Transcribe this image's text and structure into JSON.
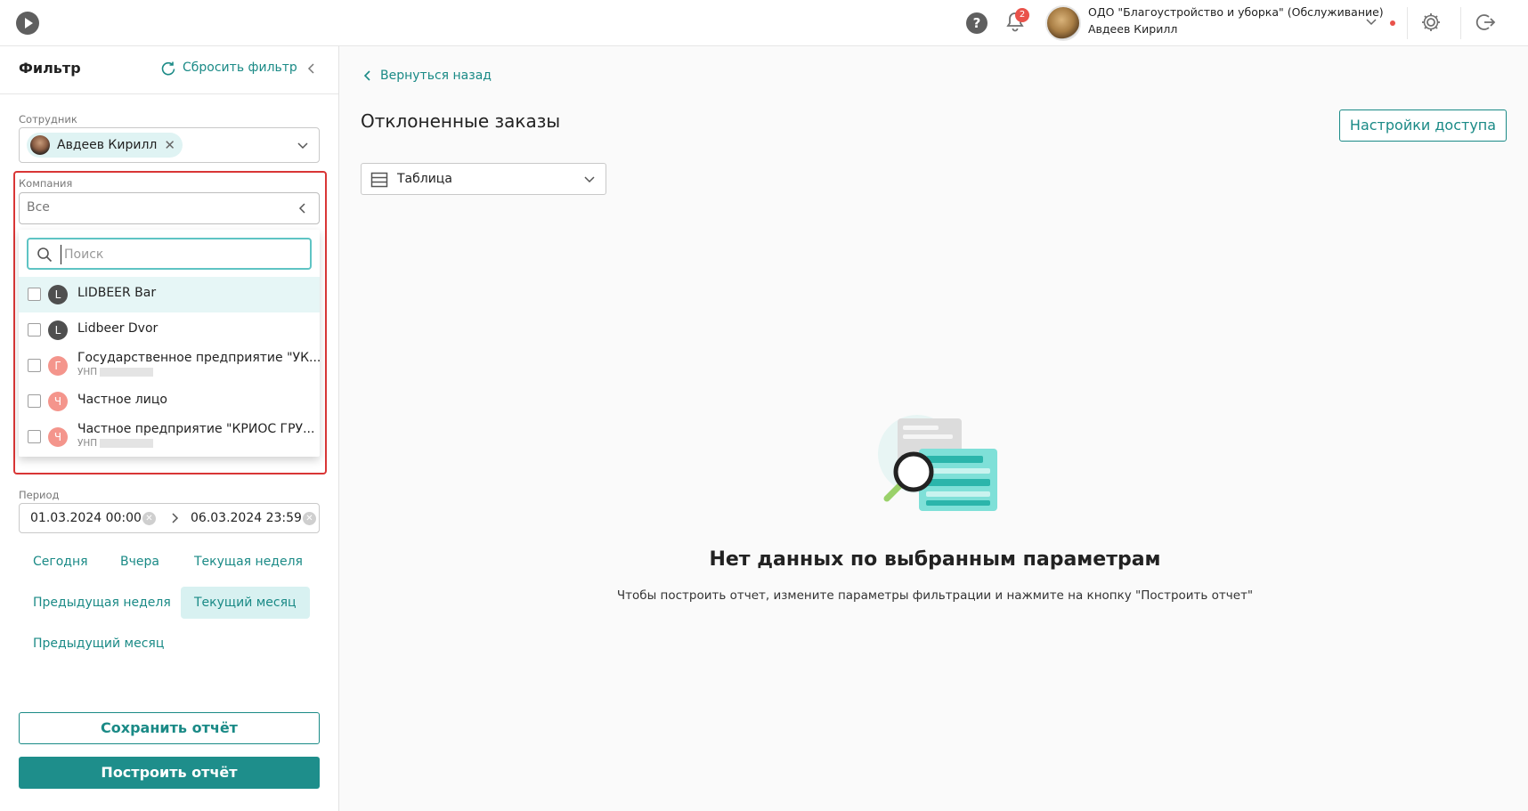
{
  "header": {
    "help_label": "?",
    "notifications_count": "2",
    "org_name": "ОДО \"Благоустройство и уборка\" (Обслуживание)",
    "user_name": "Авдеев Кирилл"
  },
  "sidebar": {
    "title": "Фильтр",
    "reset_label": "Сбросить фильтр",
    "employee": {
      "label": "Сотрудник",
      "chip": "Авдеев Кирилл"
    },
    "company": {
      "label": "Компания",
      "value": "Все",
      "search_placeholder": "Поиск",
      "options": [
        {
          "letter": "L",
          "name": "LIDBEER Bar",
          "sub": ""
        },
        {
          "letter": "L",
          "name": "Lidbeer Dvor",
          "sub": ""
        },
        {
          "letter": "Г",
          "name": "Государственное предприятие \"УК...",
          "sub": "УНП"
        },
        {
          "letter": "Ч",
          "name": "Частное лицо",
          "sub": ""
        },
        {
          "letter": "Ч",
          "name": "Частное предприятие \"КРИОС ГРУ...",
          "sub": "УНП"
        }
      ]
    },
    "period": {
      "label": "Период",
      "from": "01.03.2024 00:00",
      "to": "06.03.2024 23:59"
    },
    "quick_ranges": [
      "Сегодня",
      "Вчера",
      "Текущая неделя",
      "Предыдущая неделя",
      "Текущий месяц",
      "Предыдущий месяц"
    ],
    "active_range": "Текущий месяц",
    "save_label": "Сохранить отчёт",
    "build_label": "Построить отчёт"
  },
  "main": {
    "back_label": "Вернуться назад",
    "title": "Отклоненные заказы",
    "access_label": "Настройки доступа",
    "view_label": "Таблица",
    "empty_title": "Нет данных по выбранным параметрам",
    "empty_text": "Чтобы построить отчет, измените параметры фильтрации и нажмите на кнопку \"Построить отчет\""
  },
  "colors": {
    "accent": "#1a8a86",
    "highlight_frame": "#d93636",
    "badge": "#e9524a"
  }
}
